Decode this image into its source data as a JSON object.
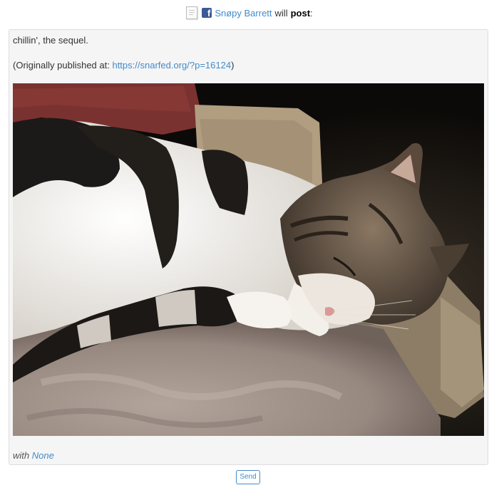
{
  "header": {
    "icon": "post-document-icon",
    "network_icon": "facebook-icon",
    "author": "Snøpy Barrett",
    "verb": "will",
    "action": "post",
    "colon": ":"
  },
  "post": {
    "text": "chillin', the sequel.",
    "published_prefix": "(Originally published at: ",
    "published_url": "https://snarfed.org/?p=16124",
    "published_suffix": ")",
    "image": "photo of a sleeping tabby-and-white cat curled on a fuzzy grey blanket",
    "with_label": "with",
    "with_value": "None"
  },
  "actions": {
    "send_label": "Send"
  },
  "colors": {
    "link": "#428bca",
    "card_background": "#f5f5f5",
    "facebook": "#3b5998"
  }
}
